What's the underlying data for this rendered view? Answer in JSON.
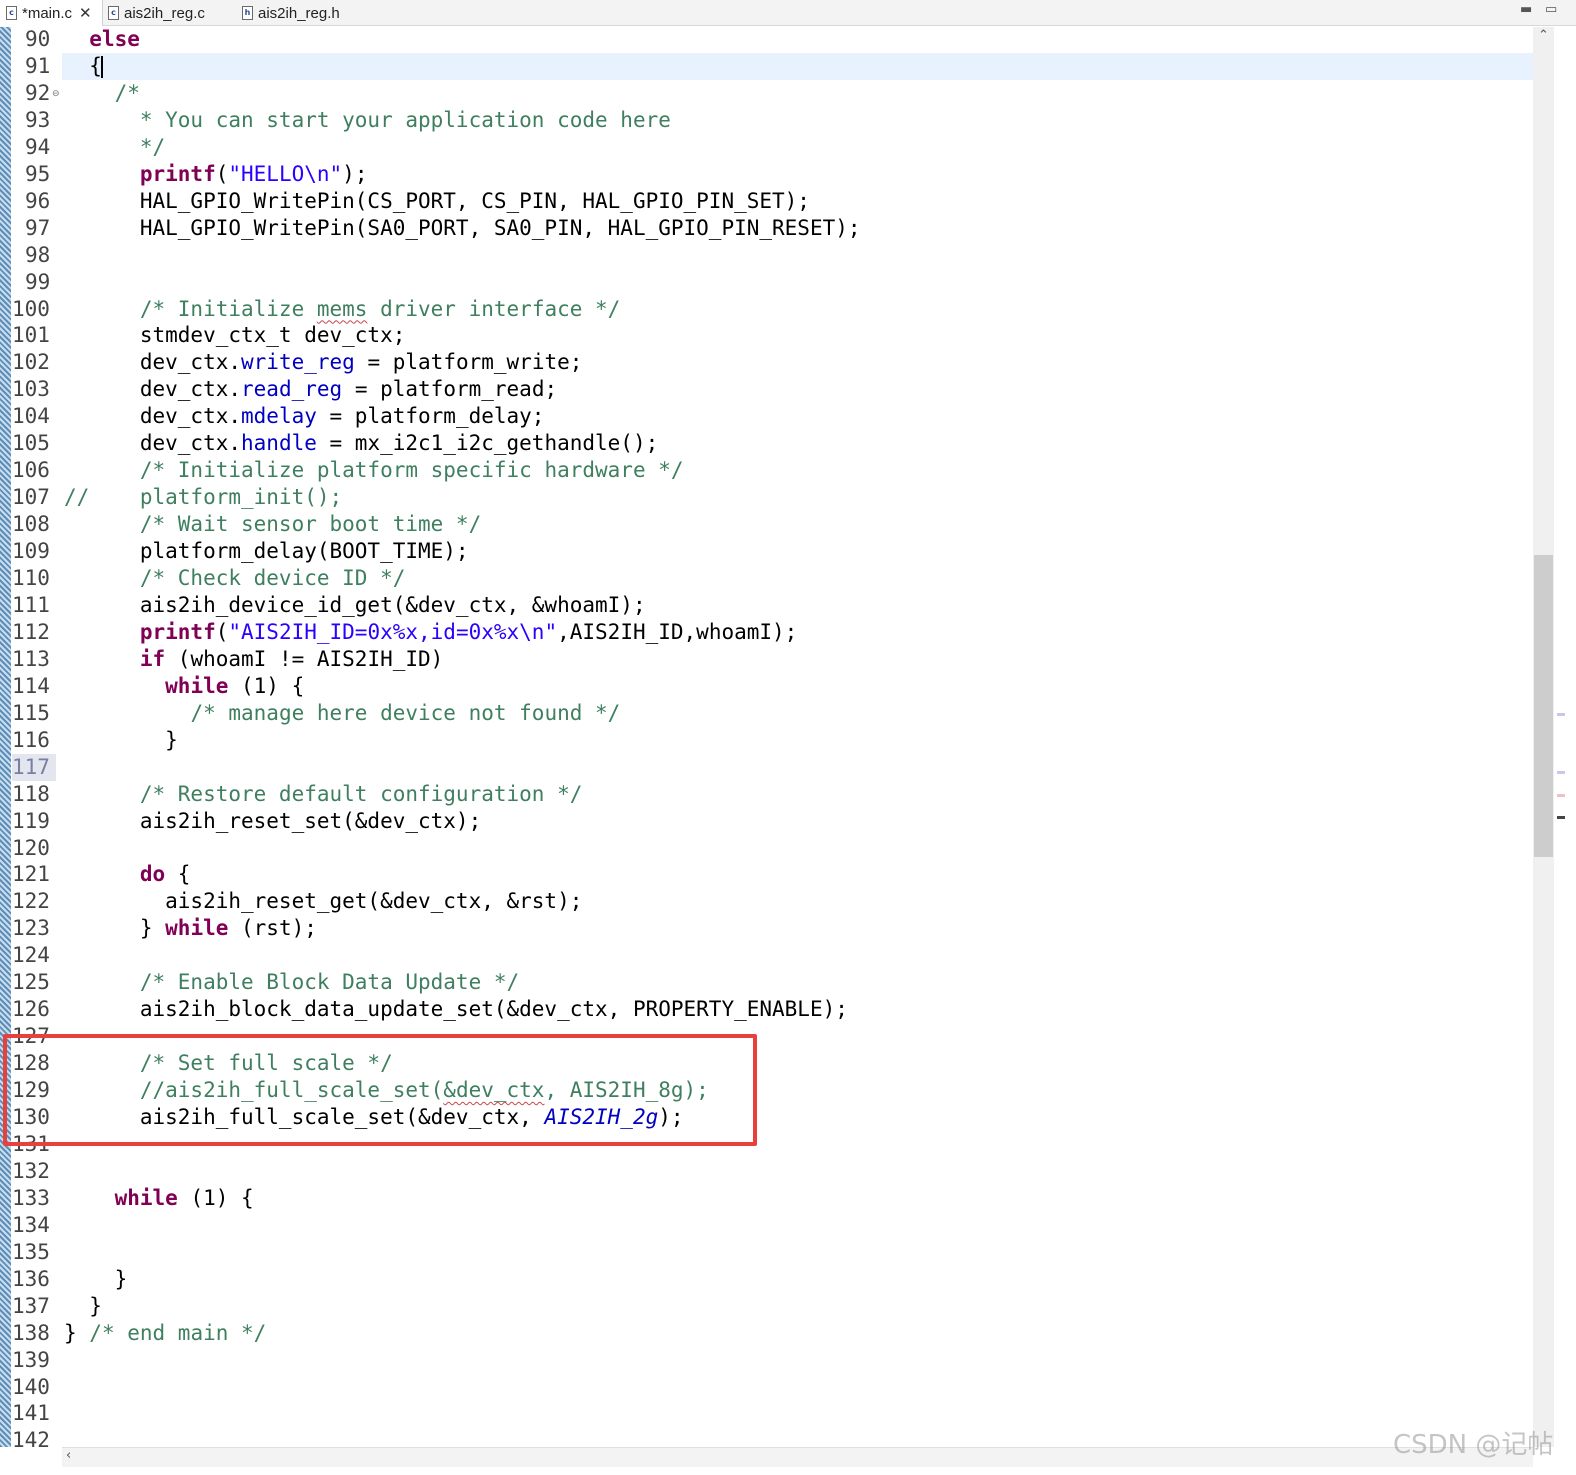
{
  "tabs": [
    {
      "label": "*main.c",
      "icon": "c-source-file-icon",
      "active": true
    },
    {
      "label": "ais2ih_reg.c",
      "icon": "c-source-file-icon",
      "active": false
    },
    {
      "label": "ais2ih_reg.h",
      "icon": "header-file-icon",
      "active": false
    }
  ],
  "editor": {
    "line_numbers": [
      "90",
      "91",
      "92",
      "93",
      "94",
      "95",
      "96",
      "97",
      "98",
      "99",
      "100",
      "101",
      "102",
      "103",
      "104",
      "105",
      "106",
      "107",
      "108",
      "109",
      "110",
      "111",
      "112",
      "113",
      "114",
      "115",
      "116",
      "117",
      "118",
      "119",
      "120",
      "121",
      "122",
      "123",
      "124",
      "125",
      "126",
      "127",
      "128",
      "129",
      "130",
      "131",
      "132",
      "133",
      "134",
      "135",
      "136",
      "137",
      "138",
      "139",
      "140",
      "141",
      "142"
    ],
    "lines": [
      [
        {
          "t": "  "
        },
        {
          "t": "else",
          "c": "kw"
        }
      ],
      [
        {
          "t": "  {"
        }
      ],
      [
        {
          "t": "    "
        },
        {
          "t": "/*",
          "c": "cmt"
        }
      ],
      [
        {
          "t": "      "
        },
        {
          "t": "* You can start your application code here",
          "c": "cmt"
        }
      ],
      [
        {
          "t": "      "
        },
        {
          "t": "*/",
          "c": "cmt"
        }
      ],
      [
        {
          "t": "      "
        },
        {
          "t": "printf",
          "c": "kw"
        },
        {
          "t": "("
        },
        {
          "t": "\"HELLO\\n\"",
          "c": "str"
        },
        {
          "t": ");"
        }
      ],
      [
        {
          "t": "      HAL_GPIO_WritePin(CS_PORT, CS_PIN, HAL_GPIO_PIN_SET);"
        }
      ],
      [
        {
          "t": "      HAL_GPIO_WritePin(SA0_PORT, SA0_PIN, HAL_GPIO_PIN_RESET);"
        }
      ],
      [],
      [],
      [
        {
          "t": "      "
        },
        {
          "t": "/* Initialize ",
          "c": "cmt"
        },
        {
          "t": "mems",
          "c": "cmt squig"
        },
        {
          "t": " driver interface */",
          "c": "cmt"
        }
      ],
      [
        {
          "t": "      stmdev_ctx_t dev_ctx;"
        }
      ],
      [
        {
          "t": "      dev_ctx."
        },
        {
          "t": "write_reg",
          "c": "fld"
        },
        {
          "t": " = platform_write;"
        }
      ],
      [
        {
          "t": "      dev_ctx."
        },
        {
          "t": "read_reg",
          "c": "fld"
        },
        {
          "t": " = platform_read;"
        }
      ],
      [
        {
          "t": "      dev_ctx."
        },
        {
          "t": "mdelay",
          "c": "fld"
        },
        {
          "t": " = platform_delay;"
        }
      ],
      [
        {
          "t": "      dev_ctx."
        },
        {
          "t": "handle",
          "c": "fld"
        },
        {
          "t": " = mx_i2c1_i2c_gethandle();"
        }
      ],
      [
        {
          "t": "      "
        },
        {
          "t": "/* Initialize platform specific hardware */",
          "c": "cmt"
        }
      ],
      [
        {
          "t": "//    platform_init();",
          "c": "cmt"
        }
      ],
      [
        {
          "t": "      "
        },
        {
          "t": "/* Wait sensor boot time */",
          "c": "cmt"
        }
      ],
      [
        {
          "t": "      platform_delay(BOOT_TIME);"
        }
      ],
      [
        {
          "t": "      "
        },
        {
          "t": "/* Check device ID */",
          "c": "cmt"
        }
      ],
      [
        {
          "t": "      ais2ih_device_id_get(&dev_ctx, &whoamI);"
        }
      ],
      [
        {
          "t": "      "
        },
        {
          "t": "printf",
          "c": "kw"
        },
        {
          "t": "("
        },
        {
          "t": "\"AIS2IH_ID=0x%x,id=0x%x\\n\"",
          "c": "str"
        },
        {
          "t": ",AIS2IH_ID,whoamI);"
        }
      ],
      [
        {
          "t": "      "
        },
        {
          "t": "if",
          "c": "kw"
        },
        {
          "t": " (whoamI != AIS2IH_ID)"
        }
      ],
      [
        {
          "t": "        "
        },
        {
          "t": "while",
          "c": "kw"
        },
        {
          "t": " (1) {"
        }
      ],
      [
        {
          "t": "          "
        },
        {
          "t": "/* manage here device not found */",
          "c": "cmt"
        }
      ],
      [
        {
          "t": "        }"
        }
      ],
      [],
      [
        {
          "t": "      "
        },
        {
          "t": "/* Restore default configuration */",
          "c": "cmt"
        }
      ],
      [
        {
          "t": "      ais2ih_reset_set(&dev_ctx);"
        }
      ],
      [],
      [
        {
          "t": "      "
        },
        {
          "t": "do",
          "c": "kw"
        },
        {
          "t": " {"
        }
      ],
      [
        {
          "t": "        ais2ih_reset_get(&dev_ctx, &rst);"
        }
      ],
      [
        {
          "t": "      } "
        },
        {
          "t": "while",
          "c": "kw"
        },
        {
          "t": " (rst);"
        }
      ],
      [],
      [
        {
          "t": "      "
        },
        {
          "t": "/* Enable Block Data Update */",
          "c": "cmt"
        }
      ],
      [
        {
          "t": "      ais2ih_block_data_update_set(&dev_ctx, PROPERTY_ENABLE);"
        }
      ],
      [],
      [
        {
          "t": "      "
        },
        {
          "t": "/* Set full scale */",
          "c": "cmt"
        }
      ],
      [
        {
          "t": "      "
        },
        {
          "t": "//ais2ih_full_scale_set(",
          "c": "cmt"
        },
        {
          "t": "&dev_ctx",
          "c": "cmt squig"
        },
        {
          "t": ", AIS2IH_8g);",
          "c": "cmt"
        }
      ],
      [
        {
          "t": "      ais2ih_full_scale_set(&dev_ctx, "
        },
        {
          "t": "AIS2IH_2g",
          "c": "mac"
        },
        {
          "t": ");"
        }
      ],
      [],
      [],
      [
        {
          "t": "    "
        },
        {
          "t": "while",
          "c": "kw"
        },
        {
          "t": " (1) {"
        }
      ],
      [],
      [],
      [
        {
          "t": "    }"
        }
      ],
      [
        {
          "t": "  }"
        }
      ],
      [
        {
          "t": "} "
        },
        {
          "t": "/* end main */",
          "c": "cmt"
        }
      ],
      [],
      [],
      [],
      []
    ]
  },
  "watermark": "CSDN @记帖"
}
